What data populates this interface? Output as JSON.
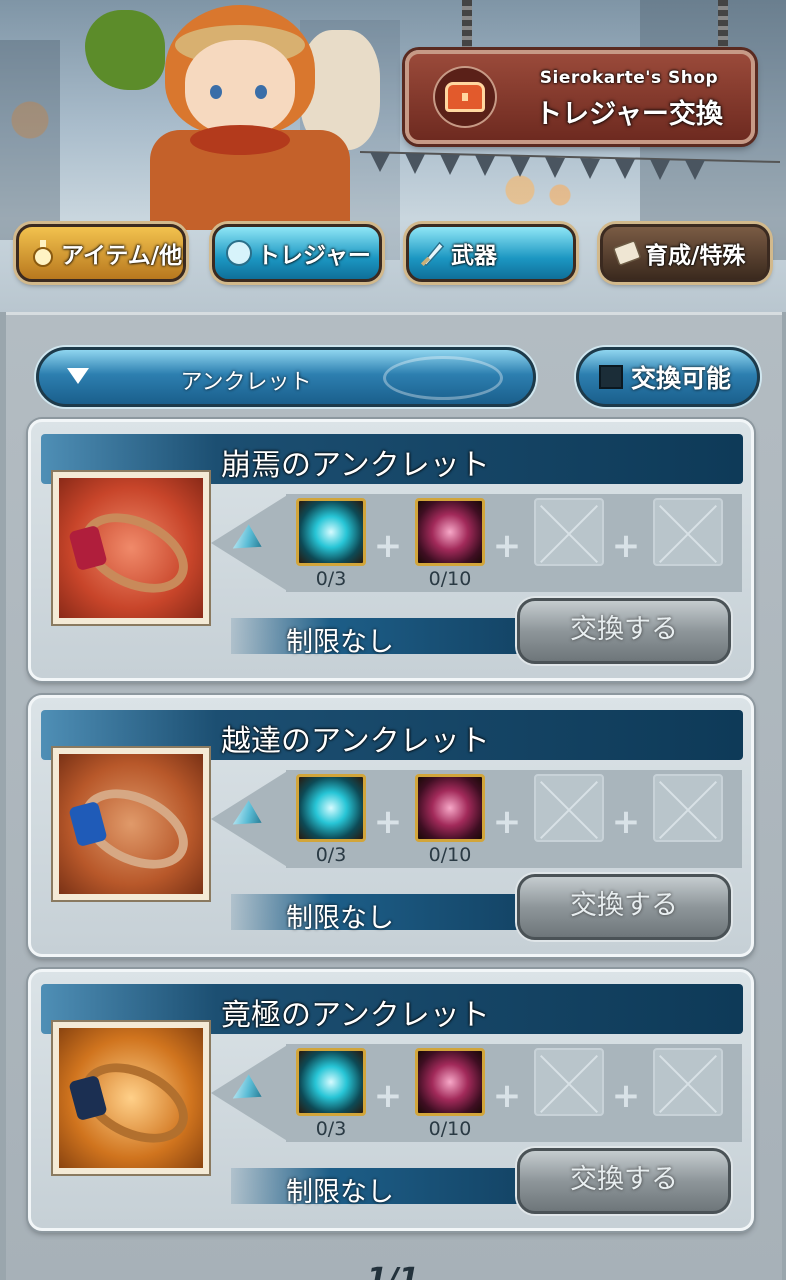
{
  "shop": {
    "sign_sub": "Sierokarte's Shop",
    "sign_main": "トレジャー交換"
  },
  "tabs": [
    {
      "label": "アイテム/他",
      "icon": "potion-icon",
      "style": "gold"
    },
    {
      "label": "トレジャー",
      "icon": "treasure-orb-icon",
      "style": "cyan"
    },
    {
      "label": "武器",
      "icon": "sword-icon",
      "style": "cyan"
    },
    {
      "label": "育成/特殊",
      "icon": "ticket-icon",
      "style": "brown"
    }
  ],
  "filter": {
    "selected": "アンクレット"
  },
  "toggle": {
    "label": "交換可能"
  },
  "items": [
    {
      "name": "崩焉のアンクレット",
      "ring_bg": "#c8452a",
      "gem_color": "#b01e3c",
      "materials": [
        {
          "count": "0/3",
          "type": "cyan-orb"
        },
        {
          "count": "0/10",
          "type": "crimson-shard"
        }
      ],
      "limit": "制限なし",
      "button": "交換する"
    },
    {
      "name": "越達のアンクレット",
      "ring_bg": "#b8582a",
      "gem_color": "#1f5bb8",
      "materials": [
        {
          "count": "0/3",
          "type": "cyan-orb"
        },
        {
          "count": "0/10",
          "type": "crimson-shard"
        }
      ],
      "limit": "制限なし",
      "button": "交換する"
    },
    {
      "name": "竟極のアンクレット",
      "ring_bg": "#d0741e",
      "gem_color": "#1b2f52",
      "materials": [
        {
          "count": "0/3",
          "type": "cyan-orb"
        },
        {
          "count": "0/10",
          "type": "crimson-shard"
        }
      ],
      "limit": "制限なし",
      "button": "交換する"
    }
  ],
  "pagination": "1/1"
}
